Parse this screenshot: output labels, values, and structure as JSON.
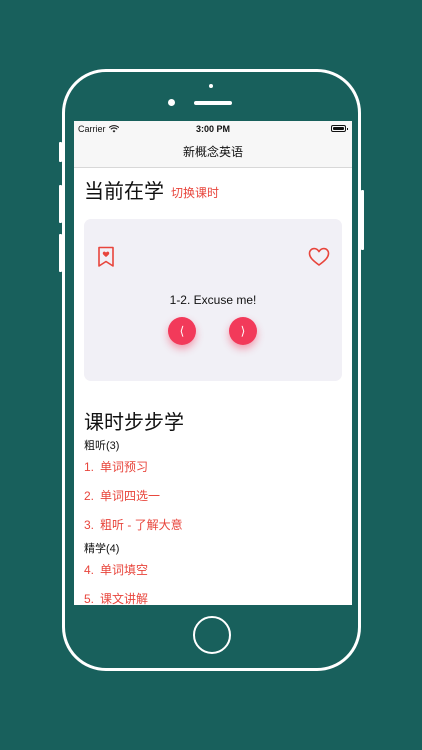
{
  "status_bar": {
    "carrier": "Carrier",
    "time": "3:00 PM"
  },
  "nav": {
    "title": "新概念英语"
  },
  "current": {
    "heading": "当前在学",
    "switch_label": "切换课时",
    "lesson_title": "1-2. Excuse me!",
    "prev_glyph": "⟨",
    "next_glyph": "⟩"
  },
  "steps": {
    "heading": "课时步步学",
    "groups": [
      {
        "label": "粗听(3)",
        "items": [
          {
            "num": "1.",
            "label": "单词预习"
          },
          {
            "num": "2.",
            "label": "单词四选一"
          },
          {
            "num": "3.",
            "label": "粗听 - 了解大意"
          }
        ]
      },
      {
        "label": "精学(4)",
        "items": [
          {
            "num": "4.",
            "label": "单词填空"
          },
          {
            "num": "5.",
            "label": "课文讲解"
          }
        ]
      }
    ]
  },
  "icons": {
    "bookmark": "bookmark-heart-icon",
    "heart": "heart-icon",
    "wifi": "wifi-icon",
    "battery": "battery-icon"
  },
  "colors": {
    "background": "#18605c",
    "accent": "#e8453c",
    "nav_button": "#f23a5a",
    "card": "#f1f0f6"
  }
}
